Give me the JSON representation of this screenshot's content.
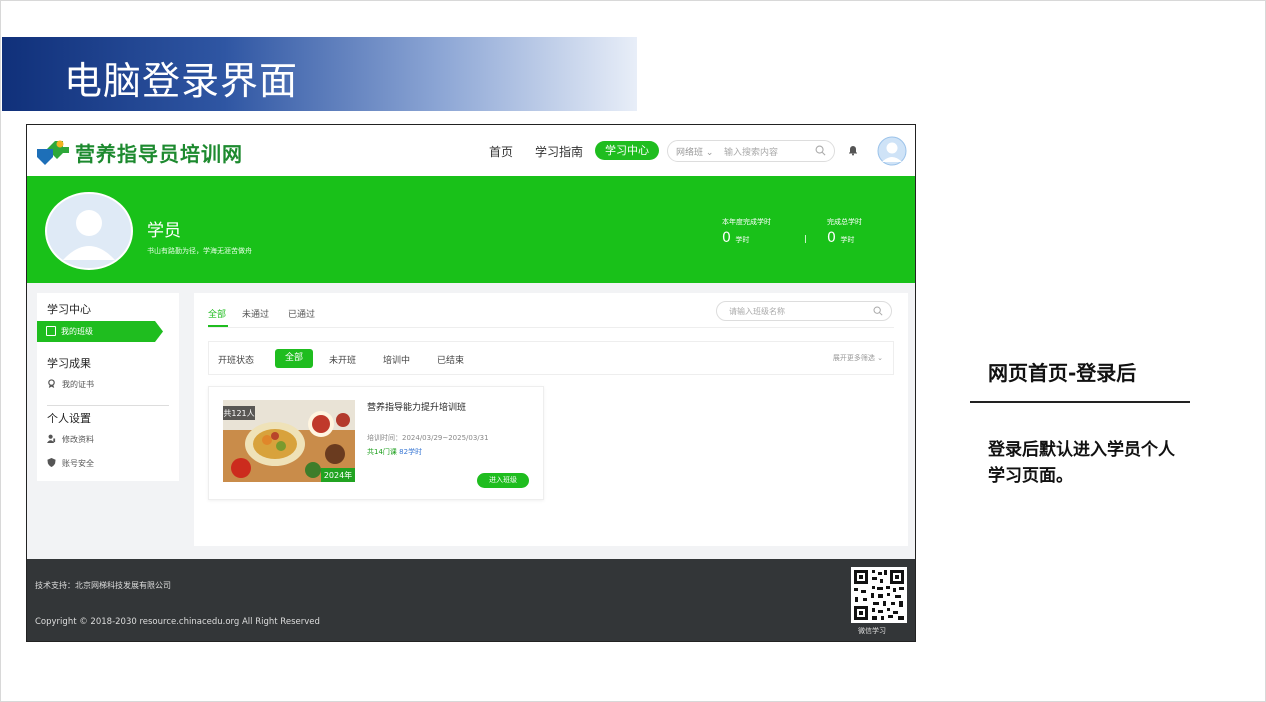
{
  "slide": {
    "title": "电脑登录界面"
  },
  "site": {
    "logo_text": "营养指导员培训网",
    "nav": {
      "home": "首页",
      "guide": "学习指南",
      "center": "学习中心"
    },
    "search": {
      "scope": "网络班 ⌄",
      "placeholder": "输入搜索内容"
    }
  },
  "profile": {
    "name": "学员",
    "motto": "书山有路勤为径，学海无涯苦做舟",
    "stats": [
      {
        "label": "本年度完成学时",
        "value": "0",
        "unit": "学时"
      },
      {
        "label": "完成总学时",
        "value": "0",
        "unit": "学时"
      }
    ]
  },
  "sidebar": {
    "sections": [
      {
        "heading": "学习中心",
        "items": [
          "我的班级"
        ]
      },
      {
        "heading": "学习成果",
        "items": [
          "我的证书"
        ]
      },
      {
        "heading": "个人设置",
        "items": [
          "修改资料",
          "账号安全"
        ]
      }
    ]
  },
  "main": {
    "tabs": [
      "全部",
      "未通过",
      "已通过"
    ],
    "search_placeholder": "请输入班级名称",
    "filter": {
      "label": "开班状态",
      "options": [
        "全部",
        "未开班",
        "培训中",
        "已结束"
      ],
      "more": "展开更多筛选 ⌄"
    },
    "card": {
      "badge_count": "共121人",
      "year_tag": "2024年",
      "title": "营养指导能力提升培训班",
      "time": "培训时间：2024/03/29~2025/03/31",
      "courses": "共14门课",
      "hours": "82学时",
      "button": "进入班级"
    }
  },
  "footer": {
    "support": "技术支持：北京网梯科技发展有限公司",
    "copyright": "Copyright © 2018-2030 resource.chinacedu.org All Right Reserved",
    "qr_label": "微信学习"
  },
  "annotation": {
    "title": "网页首页-登录后",
    "text": "登录后默认进入学员个人学习页面。"
  },
  "colors": {
    "brand_green": "#1fbd1f",
    "title_blue": "#10307a",
    "footer": "#333638"
  }
}
